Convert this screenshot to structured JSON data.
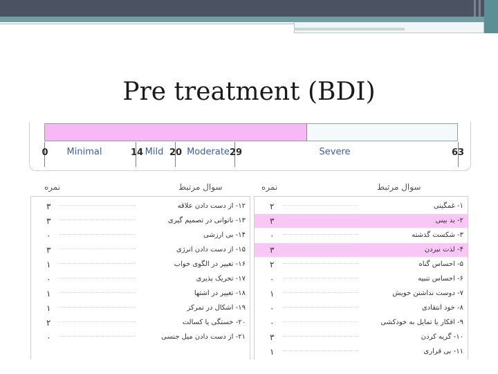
{
  "slide": {
    "title": "Pre treatment (BDI)"
  },
  "scale": {
    "min": 0,
    "max": 63,
    "score": 40,
    "fill_color": "#f6b9f6",
    "ticks": [
      "0",
      "14",
      "20",
      "29",
      "63"
    ],
    "labels": [
      "Minimal",
      "Mild",
      "Moderate",
      "Severe"
    ]
  },
  "tables": {
    "left": {
      "header_score": "نمره",
      "header_question": "سوال مرتبط",
      "rows": [
        {
          "question": "۱۲- از دست دادن علاقه",
          "score": "۳"
        },
        {
          "question": "۱۳- ناتوانی در تصمیم گیری",
          "score": "۳"
        },
        {
          "question": "۱۴- بی ارزشی",
          "score": "۰"
        },
        {
          "question": "۱۵- از دست دادن انرژی",
          "score": "۳"
        },
        {
          "question": "۱۶- تغییر در الگوی خواب",
          "score": "۱"
        },
        {
          "question": "۱۷- تحریک پذیری",
          "score": "۰"
        },
        {
          "question": "۱۸- تغییر در اشتها",
          "score": "۱"
        },
        {
          "question": "۱۹- اشکال در تمرکز",
          "score": "۱"
        },
        {
          "question": "۲۰- خستگی یا کسالت",
          "score": "۲"
        },
        {
          "question": "۲۱- از دست دادن میل جنسی",
          "score": "۰"
        }
      ]
    },
    "right": {
      "header_score": "نمره",
      "header_question": "سوال مرتبط",
      "rows": [
        {
          "question": "۱- غمگینی",
          "score": "۲"
        },
        {
          "question": "۲- بد بینی",
          "score": "۳"
        },
        {
          "question": "۳- شکست گذشته",
          "score": "۰"
        },
        {
          "question": "۴- لذت نبردن",
          "score": "۳"
        },
        {
          "question": "۵- احساس گناه",
          "score": "۲"
        },
        {
          "question": "۶- احساس تنبیه",
          "score": "۰"
        },
        {
          "question": "۷- دوست نداشتن خویش",
          "score": "۱"
        },
        {
          "question": "۸- خود انتقادی",
          "score": "۰"
        },
        {
          "question": "۹- افکار یا تمایل به خودکشی",
          "score": "۰"
        },
        {
          "question": "۱۰- گریه کردن",
          "score": "۳"
        },
        {
          "question": "۱۱- بی قراری",
          "score": "۱"
        }
      ],
      "highlight_color": "#f8c7f6"
    }
  }
}
